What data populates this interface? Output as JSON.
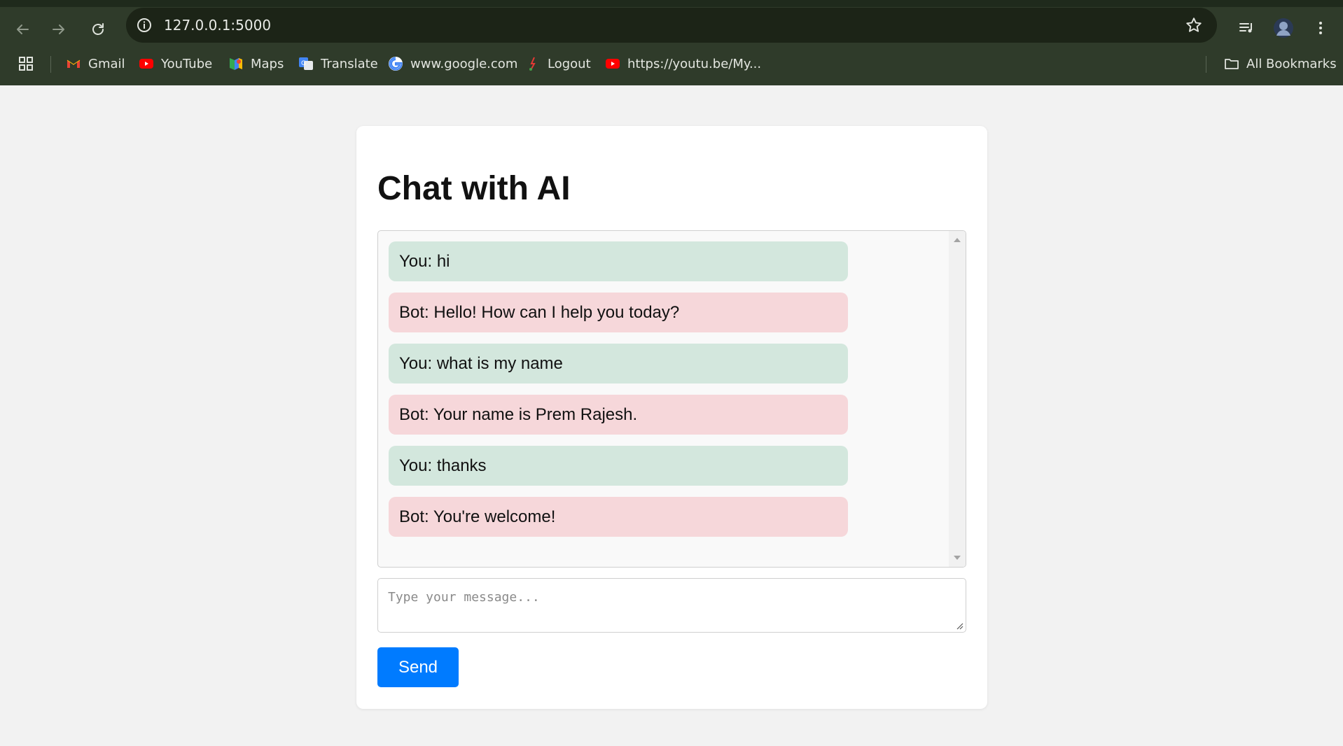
{
  "browser": {
    "url": "127.0.0.1:5000",
    "bookmarks": [
      {
        "label": "Gmail",
        "icon": "gmail-icon"
      },
      {
        "label": "YouTube",
        "icon": "youtube-icon"
      },
      {
        "label": "Maps",
        "icon": "maps-icon"
      },
      {
        "label": "Translate",
        "icon": "translate-icon"
      },
      {
        "label": "www.google.com",
        "icon": "google-icon"
      },
      {
        "label": "Logout",
        "icon": "logout-icon"
      },
      {
        "label": "https://youtu.be/My...",
        "icon": "youtube-icon"
      }
    ],
    "all_bookmarks_label": "All Bookmarks"
  },
  "page": {
    "title": "Chat with AI",
    "messages": [
      {
        "role": "user",
        "text": "You: hi"
      },
      {
        "role": "bot",
        "text": "Bot: Hello! How can I help you today?"
      },
      {
        "role": "user",
        "text": "You: what is my name"
      },
      {
        "role": "bot",
        "text": "Bot: Your name is Prem Rajesh."
      },
      {
        "role": "user",
        "text": "You: thanks"
      },
      {
        "role": "bot",
        "text": "Bot: You're welcome!"
      }
    ],
    "input": {
      "placeholder": "Type your message...",
      "value": ""
    },
    "send_label": "Send"
  },
  "colors": {
    "chrome_bg": "#2f3b2a",
    "user_bubble": "#d3e7dd",
    "bot_bubble": "#f6d7da",
    "send_button": "#007bff"
  }
}
